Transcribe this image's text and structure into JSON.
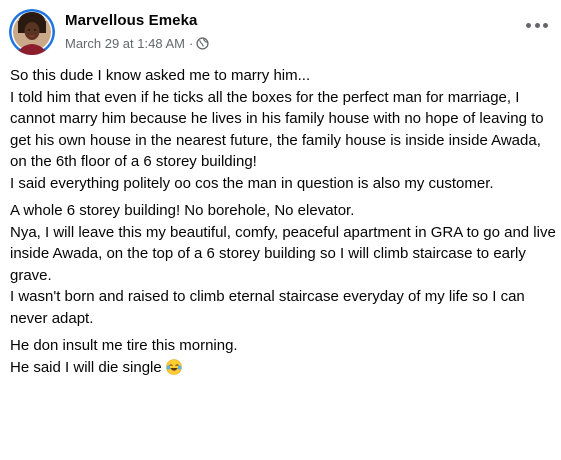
{
  "post": {
    "author": "Marvellous Emeka",
    "timestamp": "March 29 at 1:48 AM",
    "separator": "·",
    "privacy_icon": "globe-icon",
    "more_icon": "more-options-icon",
    "paragraphs": [
      [
        "So this dude I know asked me to marry him...",
        "I told him that even if he ticks all the boxes for the perfect man for marriage, I cannot marry him because he lives in his family house with no hope of leaving to get his own house in the nearest future, the family house is inside inside Awada, on the 6th floor of a 6 storey building!",
        "I said everything politely oo cos the man in question is also my customer."
      ],
      [
        "A whole 6 storey building! No borehole, No elevator.",
        "Nya, I will leave this my beautiful, comfy, peaceful apartment in GRA to go and live inside Awada, on the top of a 6 storey building so I will climb staircase to early grave.",
        "I wasn't born and raised to climb eternal staircase everyday of my life so I can never adapt."
      ],
      [
        "He don insult me tire this morning.",
        "He said I will die single"
      ]
    ],
    "trailing_emoji": "tears-of-joy-emoji"
  },
  "colors": {
    "text": "#050505",
    "secondary_text": "#65676b",
    "avatar_ring": "#1b74e4",
    "emoji_face": "#ffcc33"
  }
}
